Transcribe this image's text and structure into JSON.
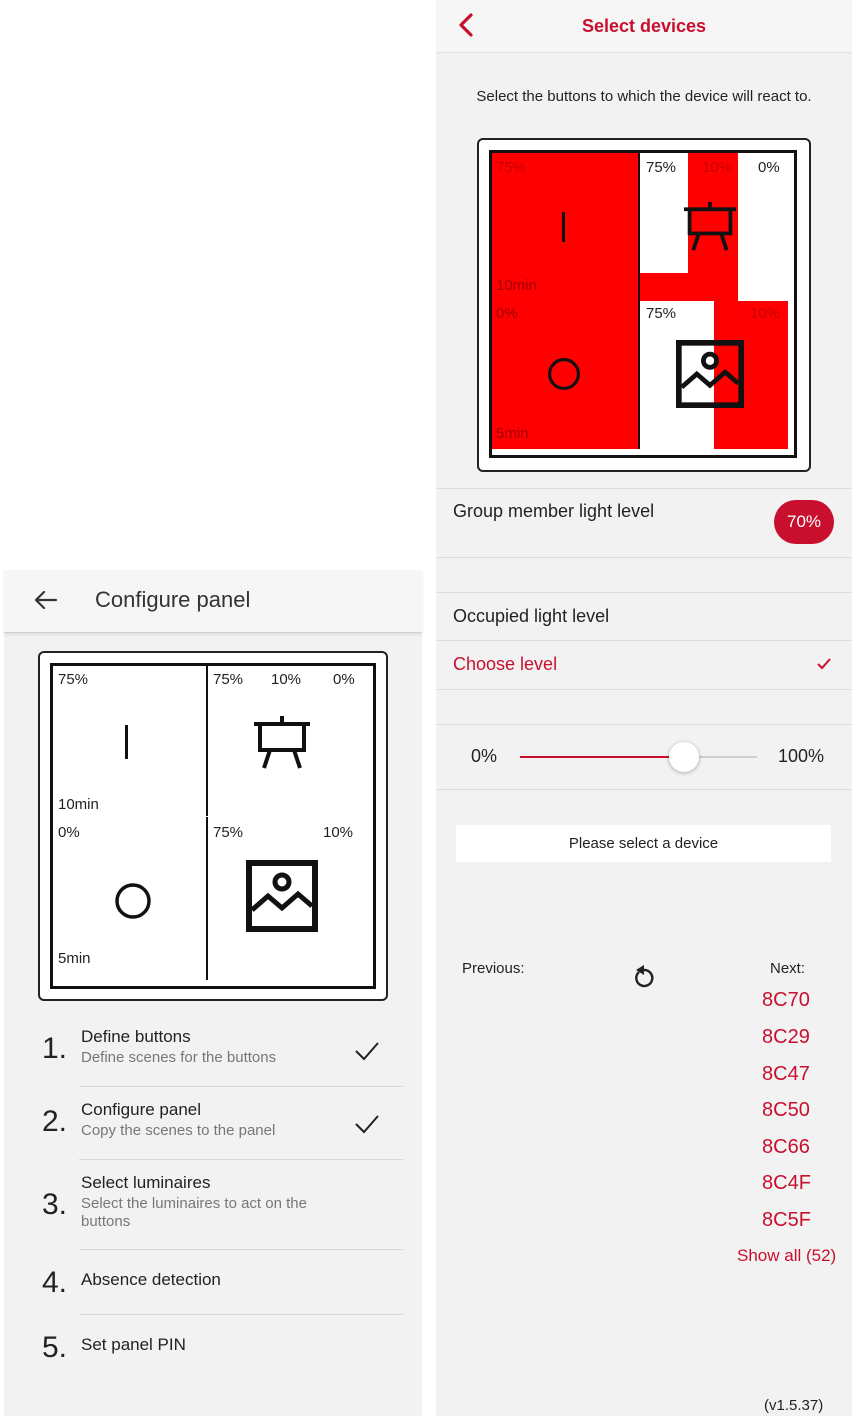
{
  "left": {
    "title": "Configure panel",
    "panel": {
      "cells": [
        {
          "top_left": "75%",
          "bottom_left": "10min"
        },
        {
          "left": "75%",
          "mid": "10%",
          "right": "0%"
        },
        {
          "top_left": "0%",
          "bottom_left": "5min"
        },
        {
          "left": "75%",
          "right": "10%"
        }
      ]
    },
    "steps": [
      {
        "num": "1.",
        "title": "Define buttons",
        "subtitle": "Define scenes for the buttons",
        "done": true
      },
      {
        "num": "2.",
        "title": "Configure panel",
        "subtitle": "Copy the scenes to the panel",
        "done": true
      },
      {
        "num": "3.",
        "title": "Select luminaires",
        "subtitle": "Select the luminaires to act on the buttons",
        "done": false
      },
      {
        "num": "4.",
        "title": "Absence detection",
        "subtitle": "",
        "done": false
      },
      {
        "num": "5.",
        "title": "Set panel PIN",
        "subtitle": "",
        "done": false
      }
    ]
  },
  "right": {
    "title": "Select devices",
    "instruction": "Select the buttons to which the device will react to.",
    "panel": {
      "cells": [
        {
          "top_left": "75%",
          "bottom_left": "10min"
        },
        {
          "left": "75%",
          "mid": "10%",
          "right": "0%"
        },
        {
          "top_left": "0%",
          "bottom_left": "5min"
        },
        {
          "left": "75%",
          "right": "10%"
        }
      ]
    },
    "group_member_label": "Group member light level",
    "group_member_value": "70%",
    "occupied_label": "Occupied light level",
    "choose_level": "Choose level",
    "slider": {
      "min_label": "0%",
      "max_label": "100%",
      "value": 0.69
    },
    "device_prompt": "Please select a device",
    "previous_label": "Previous:",
    "next_label": "Next:",
    "next_devices": [
      "8C70",
      "8C29",
      "8C47",
      "8C50",
      "8C66",
      "8C4F",
      "8C5F"
    ],
    "show_all": "Show all (52)",
    "version": "(v1.5.37)"
  },
  "colors": {
    "accent": "#c8102e",
    "selected": "#ff0000"
  }
}
